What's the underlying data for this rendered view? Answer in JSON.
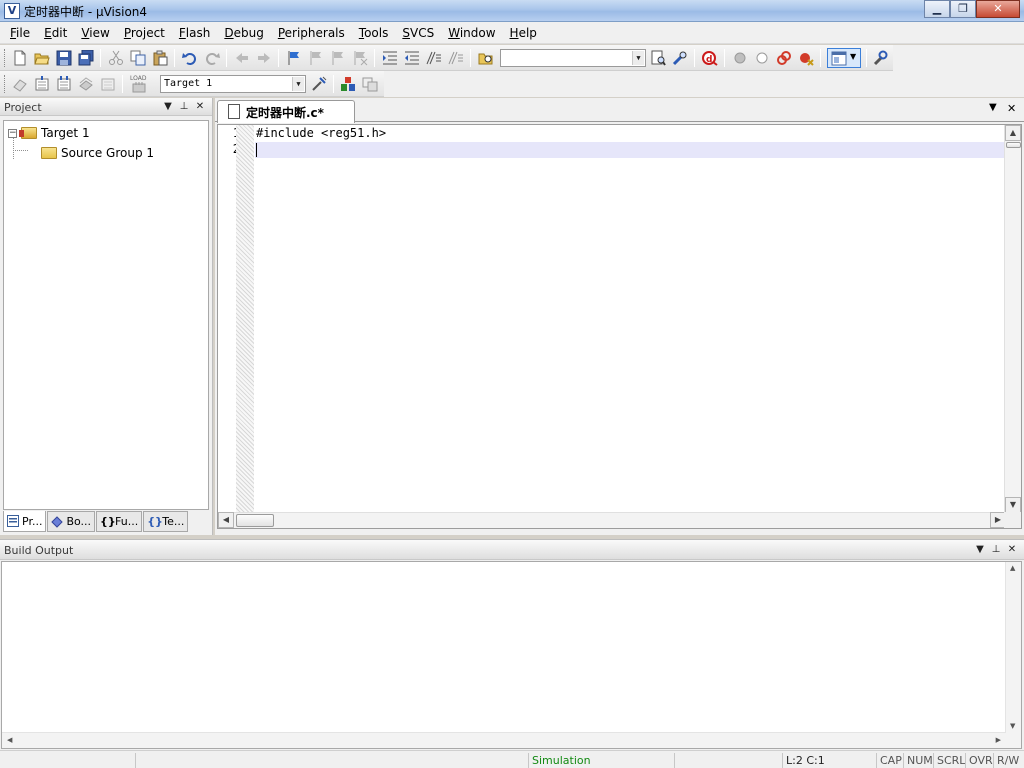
{
  "window": {
    "title": "定时器中断  - μVision4",
    "app_icon": "V"
  },
  "menu": [
    {
      "label": "File"
    },
    {
      "label": "Edit"
    },
    {
      "label": "View"
    },
    {
      "label": "Project"
    },
    {
      "label": "Flash"
    },
    {
      "label": "Debug"
    },
    {
      "label": "Peripherals"
    },
    {
      "label": "Tools"
    },
    {
      "label": "SVCS"
    },
    {
      "label": "Window"
    },
    {
      "label": "Help"
    }
  ],
  "toolbar": {
    "target_select": "Target 1",
    "load_label": "LOAD",
    "find_combo_value": ""
  },
  "project_panel": {
    "title": "Project",
    "tree": {
      "target": "Target 1",
      "group": "Source Group 1"
    },
    "tabs": [
      "Pr...",
      "Bo...",
      "Fu...",
      "Te..."
    ]
  },
  "editor": {
    "tab_label": "定时器中断.c*",
    "lines": [
      "#include <reg51.h>",
      ""
    ],
    "line_numbers": [
      "1",
      "2"
    ]
  },
  "build_output": {
    "title": "Build Output"
  },
  "status": {
    "mode": "Simulation",
    "position": "L:2 C:1",
    "cap": "CAP",
    "num": "NUM",
    "scrl": "SCRL",
    "ovr": "OVR",
    "rw": "R/W"
  },
  "colors": {
    "current_line": "#e6e6fa",
    "simulation_text": "#138a13"
  }
}
